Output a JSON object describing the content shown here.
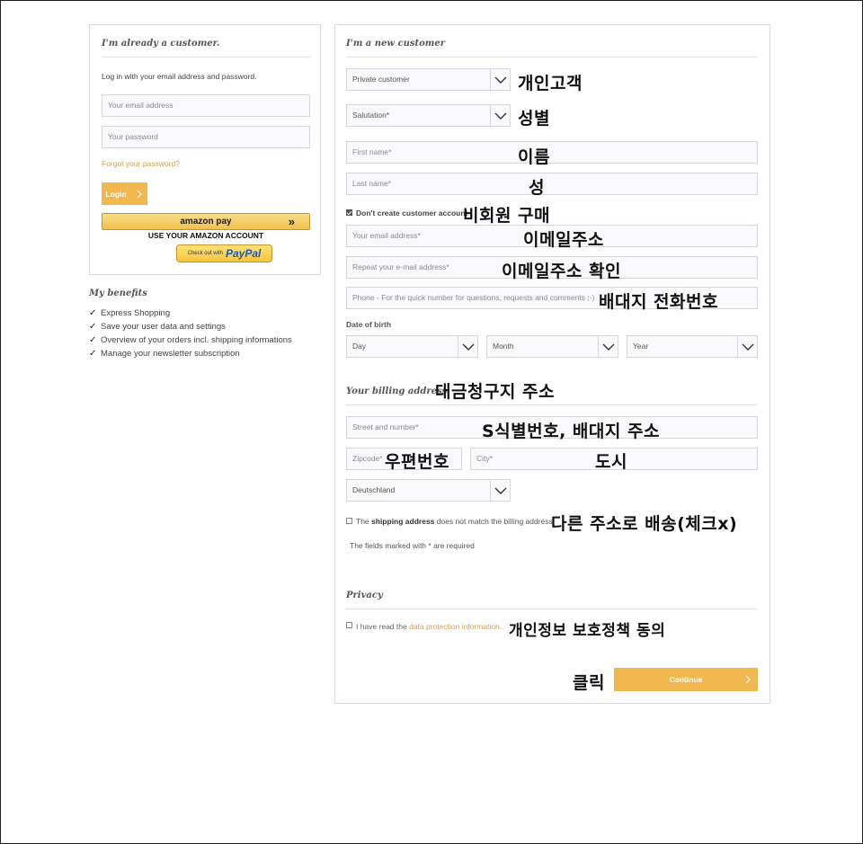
{
  "login": {
    "title": "I'm already a customer.",
    "intro": "Log in with your email address and password.",
    "email_placeholder": "Your email address",
    "password_placeholder": "Your password",
    "forgot": "Forgot your password?",
    "login_button": "Login",
    "amazon_pay_label": "amazon pay",
    "amazon_caption": "USE YOUR AMAZON ACCOUNT",
    "paypal_prefix": "Check out with",
    "paypal_brand": "PayPal"
  },
  "benefits": {
    "title": "My benefits",
    "items": [
      "Express Shopping",
      "Save your user data and settings",
      "Overview of your orders incl. shipping informations",
      "Manage your newsletter subscription"
    ]
  },
  "register": {
    "title": "I'm a new customer",
    "customer_type": "Private customer",
    "salutation": "Salutation*",
    "first_name": "First name*",
    "last_name": "Last name*",
    "no_account_label": "Don't create customer account",
    "no_account_checked": true,
    "email": "Your email address*",
    "repeat_email": "Repeat your e-mail address*",
    "phone": "Phone - For the quick number for questions, requests and comments ;-)",
    "dob_label": "Date of birth",
    "day": "Day",
    "month": "Month",
    "year": "Year",
    "billing_title": "Your billing address",
    "street": "Street and number*",
    "zip": "Zipcode*",
    "city": "City*",
    "country": "Deutschland",
    "shipping_pre": "The",
    "shipping_bold": "shipping address",
    "shipping_post": "does not match the billing address",
    "required_note": "The fields marked with * are required",
    "privacy_title": "Privacy",
    "privacy_pre": "I have read the",
    "privacy_link": "data protection information",
    "privacy_post": ".",
    "continue_button": "Continue"
  },
  "annotations": {
    "customer_type": "개인고객",
    "salutation": "성별",
    "first_name": "이름",
    "last_name": "성",
    "no_account": "비회원 구매",
    "email": "이메일주소",
    "repeat_email": "이메일주소 확인",
    "phone": "배대지 전화번호",
    "billing": "대금청구지 주소",
    "street": "S식별번호, 배대지 주소",
    "zip": "우편번호",
    "city": "도시",
    "shipping": "다른 주소로 배송(체크x)",
    "privacy": "개인정보 보호정책 동의",
    "click": "클릭"
  },
  "icons": {
    "dropdown": "chevron-down-icon",
    "check": "check-icon",
    "arrow": "chevron-right-icon"
  },
  "colors": {
    "accent": "#f1b84f",
    "link": "#d4a04a",
    "border": "#dadae5"
  }
}
